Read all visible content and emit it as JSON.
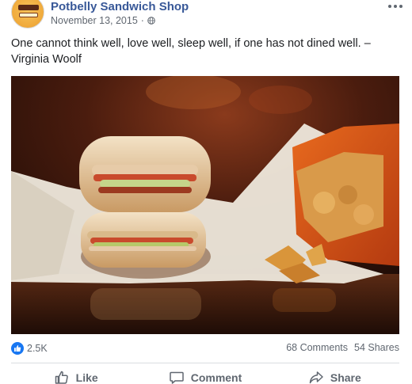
{
  "post": {
    "page_name": "Potbelly Sandwich Shop",
    "date": "November 13, 2015",
    "separator": "·",
    "privacy_icon": "globe-icon",
    "menu_icon": "more-horizontal-icon",
    "text": "One cannot think well, love well, sleep well, if one has not dined well. – Virginia Woolf",
    "photo_subject": "sandwich-and-chips-photo"
  },
  "stats": {
    "reaction_icon": "like-reaction-icon",
    "reactions_count": "2.5K",
    "comments": "68 Comments",
    "shares": "54 Shares"
  },
  "actions": {
    "like_label": "Like",
    "comment_label": "Comment",
    "share_label": "Share"
  },
  "colors": {
    "page_name": "#385898",
    "meta_text": "#606770",
    "like_blue": "#1877f2",
    "divider": "#dadde1"
  }
}
